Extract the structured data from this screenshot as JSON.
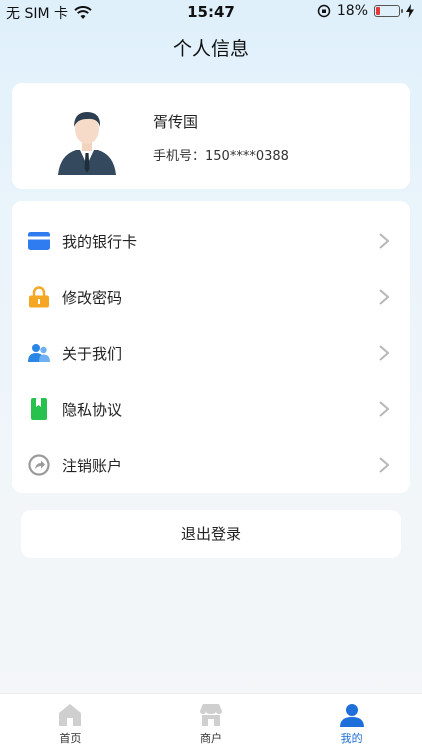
{
  "status_bar": {
    "carrier": "无 SIM 卡",
    "time": "15:47",
    "battery_percent": "18%",
    "battery_level": 0.18
  },
  "page": {
    "title": "个人信息"
  },
  "profile": {
    "name": "胥传国",
    "phone": "手机号：150****0388"
  },
  "menu": {
    "items": [
      {
        "label": "我的银行卡",
        "icon": "bank-card-icon",
        "color": "#2f7cf0"
      },
      {
        "label": "修改密码",
        "icon": "lock-icon",
        "color": "#f5a623"
      },
      {
        "label": "关于我们",
        "icon": "users-icon",
        "color": "#2b86e6"
      },
      {
        "label": "隐私协议",
        "icon": "book-icon",
        "color": "#26c24d"
      },
      {
        "label": "注销账户",
        "icon": "logout-circle-icon",
        "color": "#9a9a9a"
      }
    ]
  },
  "logout": {
    "label": "退出登录"
  },
  "tabbar": {
    "items": [
      {
        "label": "首页",
        "icon": "home-icon",
        "active": false
      },
      {
        "label": "商户",
        "icon": "shop-icon",
        "active": false
      },
      {
        "label": "我的",
        "icon": "user-icon",
        "active": true
      }
    ],
    "active_color": "#1e6fd9"
  }
}
